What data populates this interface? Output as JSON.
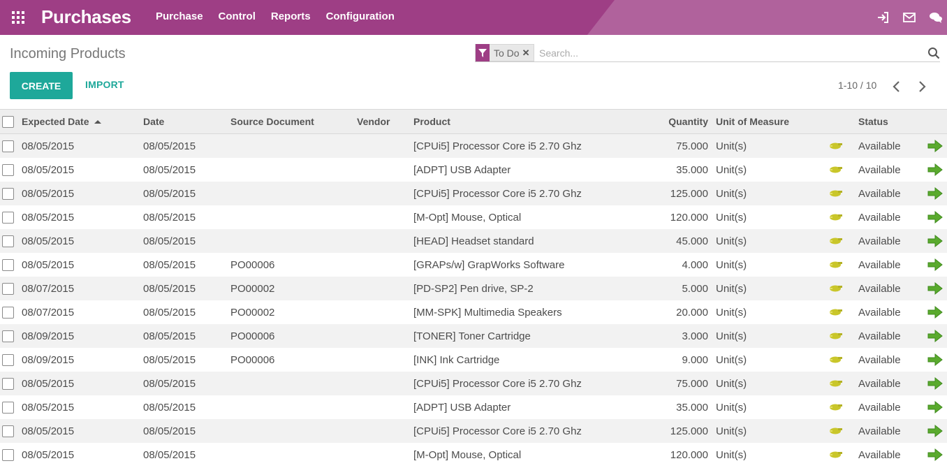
{
  "navbar": {
    "app_title": "Purchases",
    "menu": [
      "Purchase",
      "Control",
      "Reports",
      "Configuration"
    ],
    "icons": [
      "apps-grid-icon",
      "sign-in-icon",
      "envelope-icon",
      "chat-icon"
    ],
    "color": "#9e3e85"
  },
  "page": {
    "title": "Incoming Products",
    "create_label": "CREATE",
    "import_label": "IMPORT",
    "pager": "1-10 / 10"
  },
  "search": {
    "facet_label": "To Do",
    "placeholder": "Search..."
  },
  "table": {
    "columns": {
      "expected_date": "Expected Date",
      "date": "Date",
      "source": "Source Document",
      "vendor": "Vendor",
      "product": "Product",
      "quantity": "Quantity",
      "uom": "Unit of Measure",
      "status": "Status"
    },
    "rows": [
      {
        "expected_date": "08/05/2015",
        "date": "08/05/2015",
        "source": "",
        "vendor": "",
        "product": "[CPUi5] Processor Core i5 2.70 Ghz",
        "quantity": "75.000",
        "uom": "Unit(s)",
        "status": "Available"
      },
      {
        "expected_date": "08/05/2015",
        "date": "08/05/2015",
        "source": "",
        "vendor": "",
        "product": "[ADPT] USB Adapter",
        "quantity": "35.000",
        "uom": "Unit(s)",
        "status": "Available"
      },
      {
        "expected_date": "08/05/2015",
        "date": "08/05/2015",
        "source": "",
        "vendor": "",
        "product": "[CPUi5] Processor Core i5 2.70 Ghz",
        "quantity": "125.000",
        "uom": "Unit(s)",
        "status": "Available"
      },
      {
        "expected_date": "08/05/2015",
        "date": "08/05/2015",
        "source": "",
        "vendor": "",
        "product": "[M-Opt] Mouse, Optical",
        "quantity": "120.000",
        "uom": "Unit(s)",
        "status": "Available"
      },
      {
        "expected_date": "08/05/2015",
        "date": "08/05/2015",
        "source": "",
        "vendor": "",
        "product": "[HEAD] Headset standard",
        "quantity": "45.000",
        "uom": "Unit(s)",
        "status": "Available"
      },
      {
        "expected_date": "08/05/2015",
        "date": "08/05/2015",
        "source": "PO00006",
        "vendor": "",
        "product": "[GRAPs/w] GrapWorks Software",
        "quantity": "4.000",
        "uom": "Unit(s)",
        "status": "Available"
      },
      {
        "expected_date": "08/07/2015",
        "date": "08/05/2015",
        "source": "PO00002",
        "vendor": "",
        "product": "[PD-SP2] Pen drive, SP-2",
        "quantity": "5.000",
        "uom": "Unit(s)",
        "status": "Available"
      },
      {
        "expected_date": "08/07/2015",
        "date": "08/05/2015",
        "source": "PO00002",
        "vendor": "",
        "product": "[MM-SPK] Multimedia Speakers",
        "quantity": "20.000",
        "uom": "Unit(s)",
        "status": "Available"
      },
      {
        "expected_date": "08/09/2015",
        "date": "08/05/2015",
        "source": "PO00006",
        "vendor": "",
        "product": "[TONER] Toner Cartridge",
        "quantity": "3.000",
        "uom": "Unit(s)",
        "status": "Available"
      },
      {
        "expected_date": "08/09/2015",
        "date": "08/05/2015",
        "source": "PO00006",
        "vendor": "",
        "product": "[INK] Ink Cartridge",
        "quantity": "9.000",
        "uom": "Unit(s)",
        "status": "Available"
      },
      {
        "expected_date": "08/05/2015",
        "date": "08/05/2015",
        "source": "",
        "vendor": "",
        "product": "[CPUi5] Processor Core i5 2.70 Ghz",
        "quantity": "75.000",
        "uom": "Unit(s)",
        "status": "Available"
      },
      {
        "expected_date": "08/05/2015",
        "date": "08/05/2015",
        "source": "",
        "vendor": "",
        "product": "[ADPT] USB Adapter",
        "quantity": "35.000",
        "uom": "Unit(s)",
        "status": "Available"
      },
      {
        "expected_date": "08/05/2015",
        "date": "08/05/2015",
        "source": "",
        "vendor": "",
        "product": "[CPUi5] Processor Core i5 2.70 Ghz",
        "quantity": "125.000",
        "uom": "Unit(s)",
        "status": "Available"
      },
      {
        "expected_date": "08/05/2015",
        "date": "08/05/2015",
        "source": "",
        "vendor": "",
        "product": "[M-Opt] Mouse, Optical",
        "quantity": "120.000",
        "uom": "Unit(s)",
        "status": "Available"
      }
    ]
  },
  "colors": {
    "brand": "#9e3e85",
    "accent": "#1ea89a",
    "status_icon": "#c9c62a",
    "action_arrow": "#5aaa2e"
  }
}
